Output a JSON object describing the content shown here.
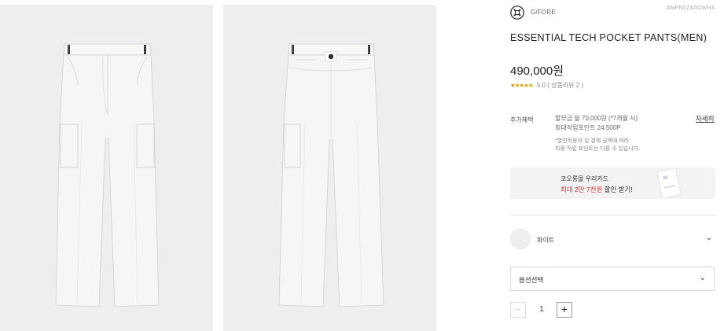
{
  "gallery": {
    "images": [
      {
        "alt": "front-view"
      },
      {
        "alt": "back-view"
      }
    ]
  },
  "product": {
    "brand": "G/FORE",
    "brand_logo_icon": "skull-cross-logo-icon",
    "sku": "GMPNS23252WHX",
    "title": "ESSENTIAL TECH POCKET PANTS(MEN)",
    "price": "490,000원",
    "rating": {
      "stars": "★★★★★",
      "score": "5.0",
      "review_text": "( 상품리뷰 2 )"
    }
  },
  "benefits": {
    "label": "추가혜택",
    "line1": "할부금 월 70,000원 (*7개월 시)",
    "line2": "최대적립포인트 24,500P",
    "note1": "*할인적용과 실 결제 금액에 따라",
    "note2": "최종 적립 포인트는 다를 수 있습니다.",
    "detail_link": "자세히"
  },
  "card_banner": {
    "line1": "코오롱몰 우리카드",
    "line2_prefix": "최대 2만 7천원",
    "line2_suffix": " 할인 받기!",
    "accent_color": "#d33333"
  },
  "color_option": {
    "label": "화이트",
    "swatch_color": "#efefef"
  },
  "option_select": {
    "label": "옵션선택"
  },
  "quantity": {
    "minus": "−",
    "value": "1",
    "plus": "+"
  }
}
